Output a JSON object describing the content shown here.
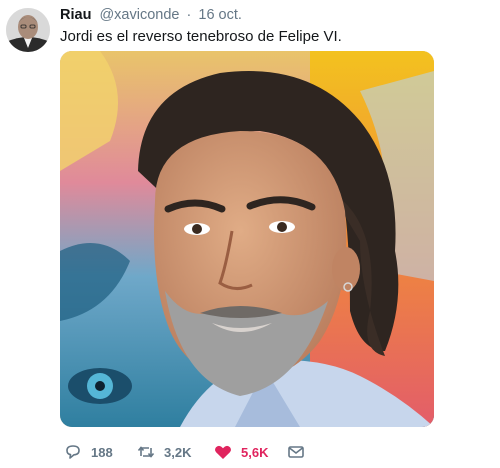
{
  "tweet": {
    "author": {
      "name": "Riau",
      "handle": "@xaviconde"
    },
    "separator": "·",
    "date": "16 oct.",
    "text": "Jordi es el reverso tenebroso de Felipe VI."
  },
  "actions": {
    "replies": {
      "icon": "reply-icon",
      "count": "188"
    },
    "retweets": {
      "icon": "retweet-icon",
      "count": "3,2K"
    },
    "likes": {
      "icon": "heart-icon",
      "count": "5,6K",
      "liked": true
    },
    "direct_message": {
      "icon": "envelope-icon"
    }
  },
  "colors": {
    "text_primary": "#14171a",
    "text_secondary": "#657786",
    "like_red": "#e0245e"
  }
}
